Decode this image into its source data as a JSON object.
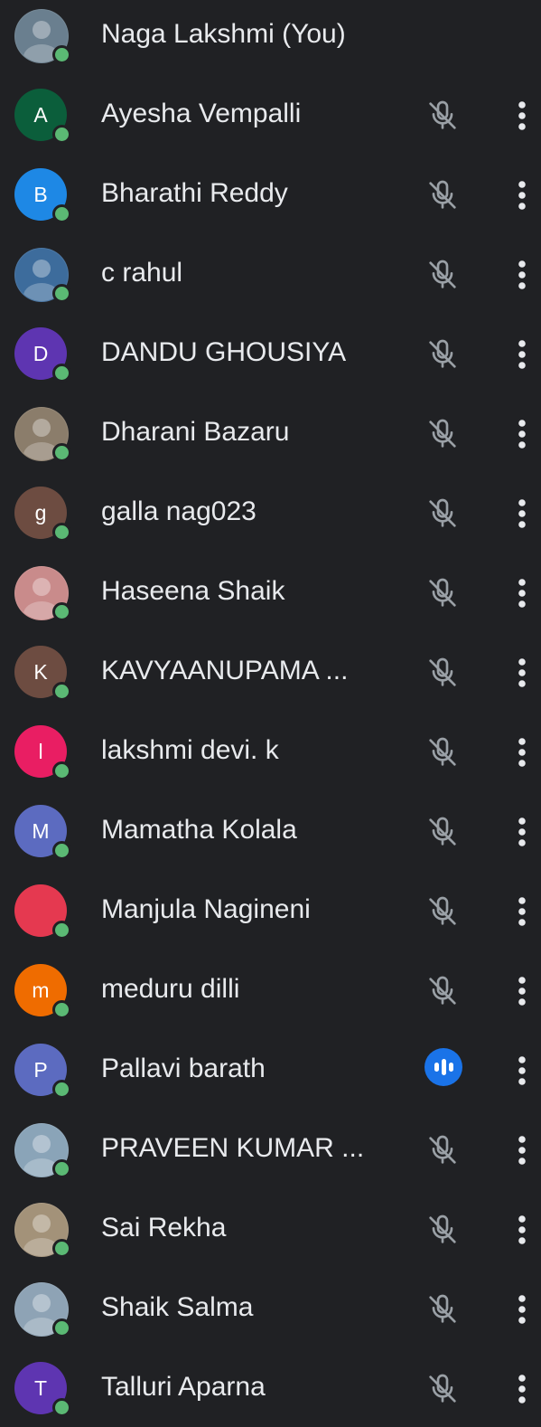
{
  "participants": [
    {
      "name": "Naga Lakshmi (You)",
      "initial": "",
      "avatar_type": "photo",
      "avatar_color": "#6a7f8f",
      "avatar_icon": "profile-photo-icon",
      "mic": "none",
      "online": true
    },
    {
      "name": "Ayesha Vempalli",
      "initial": "A",
      "avatar_type": "letter",
      "avatar_color": "#0b5e3b",
      "mic": "muted",
      "online": true
    },
    {
      "name": "Bharathi Reddy",
      "initial": "B",
      "avatar_type": "letter",
      "avatar_color": "#1e88e5",
      "mic": "muted",
      "online": true
    },
    {
      "name": "c rahul",
      "initial": "",
      "avatar_type": "photo",
      "avatar_color": "#3d6c9c",
      "avatar_icon": "profile-photo-icon",
      "mic": "muted",
      "online": true
    },
    {
      "name": "DANDU GHOUSIYA",
      "initial": "D",
      "avatar_type": "letter",
      "avatar_color": "#5e35b1",
      "mic": "muted",
      "online": true
    },
    {
      "name": "Dharani Bazaru",
      "initial": "",
      "avatar_type": "photo",
      "avatar_color": "#8b7d6b",
      "avatar_icon": "profile-photo-icon",
      "mic": "muted",
      "online": true
    },
    {
      "name": "galla nag023",
      "initial": "g",
      "avatar_type": "letter",
      "avatar_color": "#6d4c41",
      "mic": "muted",
      "online": true
    },
    {
      "name": "Haseena Shaik",
      "initial": "",
      "avatar_type": "photo",
      "avatar_color": "#c98b8b",
      "avatar_icon": "profile-photo-icon",
      "mic": "muted",
      "online": true
    },
    {
      "name": "KAVYAANUPAMA ...",
      "initial": "K",
      "avatar_type": "letter",
      "avatar_color": "#6d4c41",
      "mic": "muted",
      "online": true
    },
    {
      "name": "lakshmi devi. k",
      "initial": "l",
      "avatar_type": "letter",
      "avatar_color": "#e91e63",
      "mic": "muted",
      "online": true
    },
    {
      "name": "Mamatha Kolala",
      "initial": "M",
      "avatar_type": "letter",
      "avatar_color": "#5c6bc0",
      "mic": "muted",
      "online": true
    },
    {
      "name": "Manjula Nagineni",
      "initial": "",
      "avatar_type": "letter",
      "avatar_color": "#e53950",
      "mic": "muted",
      "online": true
    },
    {
      "name": "meduru dilli",
      "initial": "m",
      "avatar_type": "letter",
      "avatar_color": "#ef6c00",
      "mic": "muted",
      "online": true
    },
    {
      "name": "Pallavi barath",
      "initial": "P",
      "avatar_type": "letter",
      "avatar_color": "#5c6bc0",
      "mic": "speaking",
      "online": true
    },
    {
      "name": "PRAVEEN KUMAR ...",
      "initial": "",
      "avatar_type": "photo",
      "avatar_color": "#8aa4b8",
      "avatar_icon": "profile-photo-icon",
      "mic": "muted",
      "online": true
    },
    {
      "name": "Sai Rekha",
      "initial": "",
      "avatar_type": "photo",
      "avatar_color": "#a39279",
      "avatar_icon": "profile-photo-icon",
      "mic": "muted",
      "online": true
    },
    {
      "name": "Shaik Salma",
      "initial": "",
      "avatar_type": "photo",
      "avatar_color": "#8ea3b5",
      "avatar_icon": "profile-photo-icon",
      "mic": "muted",
      "online": true
    },
    {
      "name": "Talluri Aparna",
      "initial": "T",
      "avatar_type": "letter",
      "avatar_color": "#5e35b1",
      "mic": "muted",
      "online": true
    }
  ],
  "colors": {
    "background": "#202124",
    "text": "#e8eaed",
    "icon": "#9aa0a6",
    "online": "#5bb974",
    "speaking": "#1a73e8"
  },
  "icons": {
    "muted": "mic-off-icon",
    "speaking": "audio-speaking-icon",
    "more": "more-vert-icon",
    "online": "online-status-icon"
  }
}
